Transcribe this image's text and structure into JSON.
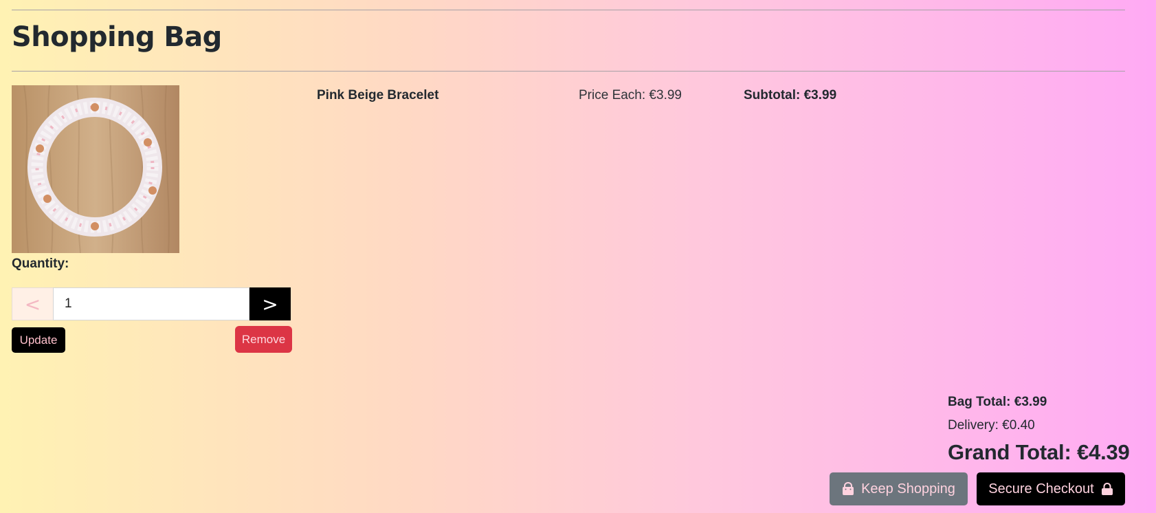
{
  "page": {
    "title": "Shopping Bag"
  },
  "item": {
    "name": "Pink Beige Bracelet",
    "price_each": "Price Each: €3.99",
    "subtotal": "Subtotal: €3.99",
    "quantity_label": "Quantity:",
    "quantity_value": "1",
    "decrease_label": "<",
    "increase_label": ">",
    "update_label": "Update",
    "remove_label": "Remove"
  },
  "totals": {
    "bag_total": "Bag Total: €3.99",
    "delivery": "Delivery: €0.40",
    "grand_total": "Grand Total: €4.39"
  },
  "actions": {
    "keep_shopping_label": "Keep Shopping",
    "secure_checkout_label": "Secure Checkout"
  },
  "colors": {
    "remove_button": "#dc3545",
    "keep_shopping_button": "#6c757d",
    "secure_checkout_button": "#000000"
  },
  "icons": {
    "keep_shopping": "shopping-bag-icon",
    "secure_checkout": "lock-icon"
  }
}
